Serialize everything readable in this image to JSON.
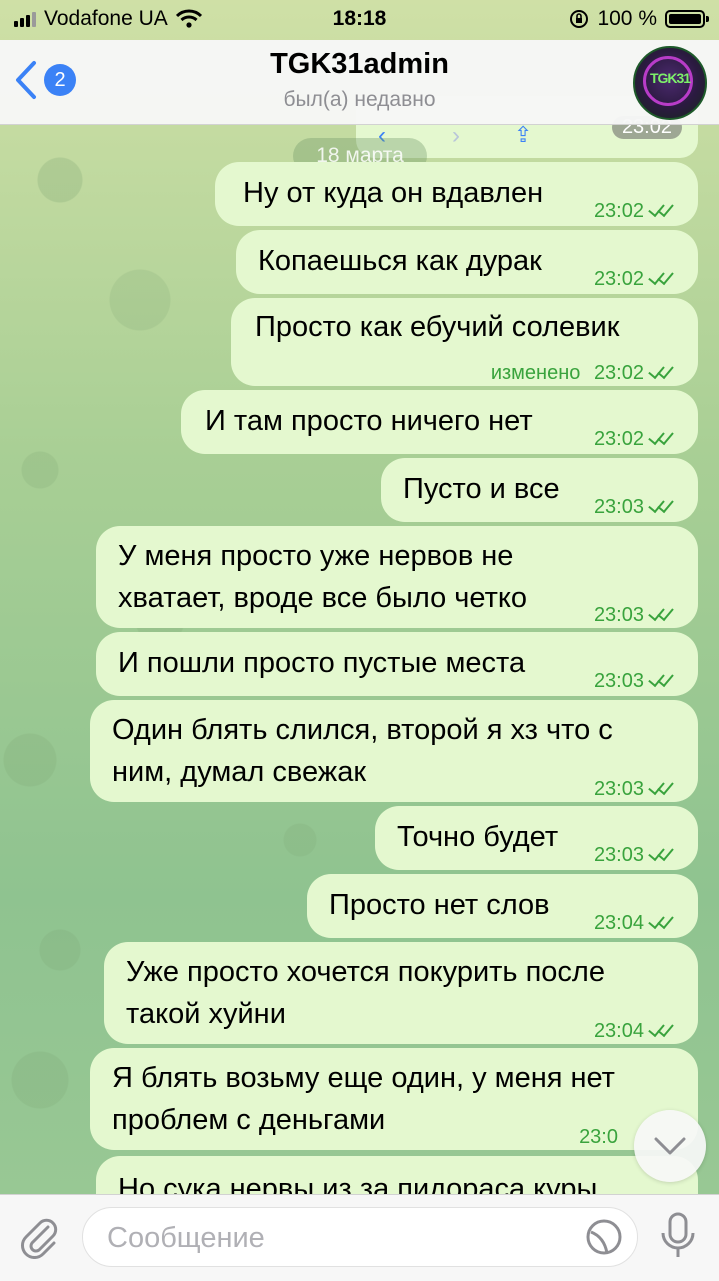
{
  "status_bar": {
    "carrier": "Vodafone UA",
    "time": "18:18",
    "battery": "100 %"
  },
  "header": {
    "back_count": "2",
    "title": "TGK31admin",
    "subtitle": "был(а) недавно",
    "avatar_text": "TGK31"
  },
  "date_separator": "18 марта",
  "top_partial_time": "23:02",
  "messages": [
    {
      "text": "Ну от куда он вдавлен",
      "time": "23:02"
    },
    {
      "text": "Копаешься как дурак",
      "time": "23:02"
    },
    {
      "text": "Просто как ебучий солевик",
      "edited": "изменено",
      "time": "23:02"
    },
    {
      "text": "И там просто ничего нет",
      "time": "23:02"
    },
    {
      "text": "Пусто и все",
      "time": "23:03"
    },
    {
      "line1": "У меня просто уже нервов не",
      "line2": "хватает, вроде все было четко",
      "time": "23:03"
    },
    {
      "text": "И пошли просто пустые места",
      "time": "23:03"
    },
    {
      "line1": "Один блять слился, второй я хз что с",
      "line2": "ним, думал свежак",
      "time": "23:03"
    },
    {
      "text": "Точно будет",
      "time": "23:03"
    },
    {
      "text": "Просто нет слов",
      "time": "23:04"
    },
    {
      "line1": "Уже просто хочется покурить после",
      "line2": "такой хуйни",
      "time": "23:04"
    },
    {
      "line1": "Я блять возьму еще один, у меня нет",
      "line2": "проблем с деньгами",
      "time": "23:0"
    },
    {
      "text": "Но сука нервы из за пидораса куры"
    }
  ],
  "input": {
    "placeholder": "Сообщение"
  },
  "colors": {
    "bubble": "#e4f8cf",
    "accent": "#3b82f6",
    "tick": "#39a33d"
  }
}
